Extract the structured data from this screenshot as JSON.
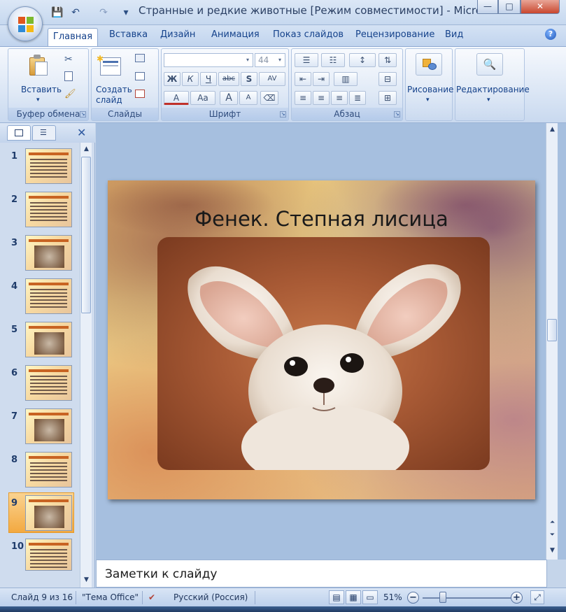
{
  "window": {
    "title": "Странные и редкие животные [Режим совместимости] - Microsof...",
    "min_label": "—",
    "max_label": "□",
    "close_label": "✕"
  },
  "quick_access": {
    "save": "💾",
    "undo": "↶",
    "redo": "↷",
    "customize": "▾"
  },
  "tabs": [
    {
      "label": "Главная",
      "active": true
    },
    {
      "label": "Вставка"
    },
    {
      "label": "Дизайн"
    },
    {
      "label": "Анимация"
    },
    {
      "label": "Показ слайдов"
    },
    {
      "label": "Рецензирование"
    },
    {
      "label": "Вид"
    }
  ],
  "ribbon": {
    "clipboard": {
      "label": "Буфер обмена",
      "paste": "Вставить"
    },
    "slides": {
      "label": "Слайды",
      "new_slide_1": "Создать",
      "new_slide_2": "слайд"
    },
    "font": {
      "label": "Шрифт",
      "font_size": "44",
      "bold": "Ж",
      "italic": "К",
      "underline": "Ч",
      "strike": "abc",
      "shadow": "S",
      "spacing": "AV",
      "color": "A",
      "case": "Aa",
      "grow": "A",
      "shrink": "A"
    },
    "paragraph": {
      "label": "Абзац"
    },
    "drawing": {
      "label": "Рисование"
    },
    "editing": {
      "label": "Редактирование"
    }
  },
  "slides_pane": {
    "numbers": [
      "1",
      "2",
      "3",
      "4",
      "5",
      "6",
      "7",
      "8",
      "9",
      "10"
    ],
    "selected": 9
  },
  "slide": {
    "title": "Фенек. Степная лисица"
  },
  "notes": {
    "placeholder": "Заметки к слайду"
  },
  "status": {
    "slide_pos": "Слайд 9 из 16",
    "theme": "\"Тема Office\"",
    "language": "Русский (Россия)",
    "zoom": "51%",
    "zoom_fraction": 0.2
  },
  "colors": {
    "accent": "#15428b",
    "ribbon_bg": "#dbe6f5",
    "selection": "#f3a941"
  }
}
